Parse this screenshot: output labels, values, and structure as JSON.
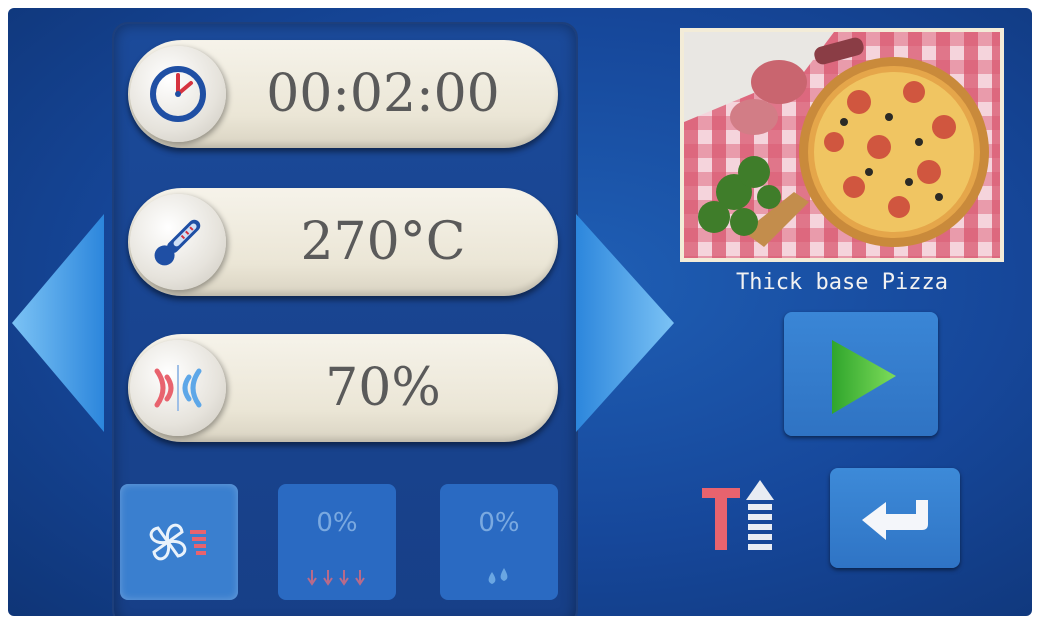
{
  "timer": {
    "value": "00:02:00",
    "icon": "clock-icon"
  },
  "temperature": {
    "value": "270°C",
    "icon": "thermometer-icon"
  },
  "power": {
    "value": "70%",
    "icon": "airflow-icon"
  },
  "fan": {
    "icon": "fan-icon"
  },
  "steam": {
    "value": "0%",
    "icon": "steam-drops-icon"
  },
  "humidity": {
    "value": "0%",
    "icon": "water-drops-icon"
  },
  "recipe": {
    "name": "Thick base Pizza"
  },
  "controls": {
    "play_icon": "play-icon",
    "back_icon": "return-icon",
    "temp_up_icon": "temp-up-icon"
  },
  "colors": {
    "background": "#1a4da0",
    "pill": "#f0ece0",
    "accent_red": "#e8636e",
    "play_green": "#3fb83a"
  }
}
